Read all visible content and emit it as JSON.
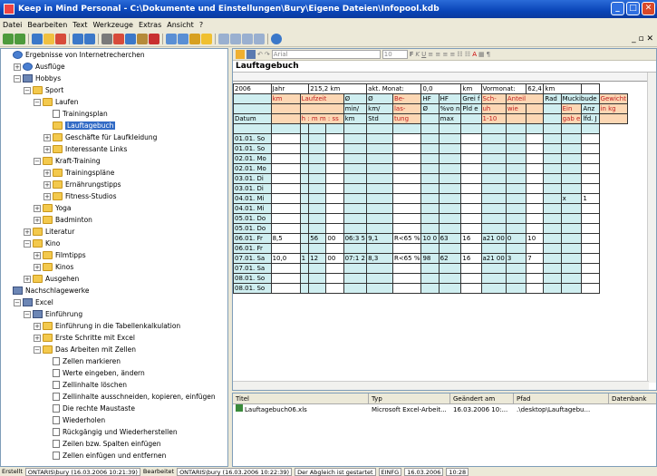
{
  "window": {
    "title": "Keep in Mind Personal - C:\\Dokumente und Einstellungen\\Bury\\Eigene Dateien\\Infopool.kdb"
  },
  "menu": [
    "Datei",
    "Bearbeiten",
    "Text",
    "Werkzeuge",
    "Extras",
    "Ansicht",
    "?"
  ],
  "format": {
    "font": "Arial",
    "size": "10"
  },
  "tree": [
    {
      "label": "Ergebnisse von Internetrecherchen",
      "depth": 0,
      "icon": "globe",
      "pm": ""
    },
    {
      "label": "Ausflüge",
      "depth": 1,
      "icon": "globe",
      "pm": "+"
    },
    {
      "label": "Hobbys",
      "depth": 1,
      "icon": "book",
      "pm": "-"
    },
    {
      "label": "Sport",
      "depth": 2,
      "icon": "folder",
      "pm": "-"
    },
    {
      "label": "Laufen",
      "depth": 3,
      "icon": "folder",
      "pm": "-"
    },
    {
      "label": "Trainingsplan",
      "depth": 4,
      "icon": "page",
      "pm": ""
    },
    {
      "label": "Lauftagebuch",
      "depth": 4,
      "icon": "folder",
      "pm": "",
      "selected": true
    },
    {
      "label": "Geschäfte für Laufkleidung",
      "depth": 4,
      "icon": "folder",
      "pm": "+"
    },
    {
      "label": "Interessante Links",
      "depth": 4,
      "icon": "folder",
      "pm": "+"
    },
    {
      "label": "Kraft-Training",
      "depth": 3,
      "icon": "folder",
      "pm": "-"
    },
    {
      "label": "Trainingspläne",
      "depth": 4,
      "icon": "folder",
      "pm": "+"
    },
    {
      "label": "Ernährungstipps",
      "depth": 4,
      "icon": "folder",
      "pm": "+"
    },
    {
      "label": "Fitness-Studios",
      "depth": 4,
      "icon": "folder",
      "pm": "+"
    },
    {
      "label": "Yoga",
      "depth": 3,
      "icon": "folder",
      "pm": "+"
    },
    {
      "label": "Badminton",
      "depth": 3,
      "icon": "folder",
      "pm": "+"
    },
    {
      "label": "Literatur",
      "depth": 2,
      "icon": "folder",
      "pm": "+"
    },
    {
      "label": "Kino",
      "depth": 2,
      "icon": "folder",
      "pm": "-"
    },
    {
      "label": "Filmtipps",
      "depth": 3,
      "icon": "folder",
      "pm": "+"
    },
    {
      "label": "Kinos",
      "depth": 3,
      "icon": "folder",
      "pm": "+"
    },
    {
      "label": "Ausgehen",
      "depth": 2,
      "icon": "folder",
      "pm": "+"
    },
    {
      "label": "Nachschlagewerke",
      "depth": 0,
      "icon": "book",
      "pm": ""
    },
    {
      "label": "Excel",
      "depth": 1,
      "icon": "book",
      "pm": "-"
    },
    {
      "label": "Einführung",
      "depth": 2,
      "icon": "book",
      "pm": "-"
    },
    {
      "label": "Einführung in die Tabellenkalkulation",
      "depth": 3,
      "icon": "folder",
      "pm": "+"
    },
    {
      "label": "Erste Schritte mit Excel",
      "depth": 3,
      "icon": "folder",
      "pm": "+"
    },
    {
      "label": "Das Arbeiten mit Zellen",
      "depth": 3,
      "icon": "folder",
      "pm": "-"
    },
    {
      "label": "Zellen markieren",
      "depth": 4,
      "icon": "page",
      "pm": ""
    },
    {
      "label": "Werte eingeben, ändern",
      "depth": 4,
      "icon": "page",
      "pm": ""
    },
    {
      "label": "Zellinhalte löschen",
      "depth": 4,
      "icon": "page",
      "pm": ""
    },
    {
      "label": "Zellinhalte ausschneiden, kopieren, einfügen",
      "depth": 4,
      "icon": "page",
      "pm": ""
    },
    {
      "label": "Die rechte Maustaste",
      "depth": 4,
      "icon": "page",
      "pm": ""
    },
    {
      "label": "Wiederholen",
      "depth": 4,
      "icon": "page",
      "pm": ""
    },
    {
      "label": "Rückgängig und Wiederherstellen",
      "depth": 4,
      "icon": "page",
      "pm": ""
    },
    {
      "label": "Zeilen bzw. Spalten einfügen",
      "depth": 4,
      "icon": "page",
      "pm": ""
    },
    {
      "label": "Zellen einfügen und entfernen",
      "depth": 4,
      "icon": "page",
      "pm": ""
    }
  ],
  "doc": {
    "title": "Lauftagebuch"
  },
  "sheet": {
    "h1": [
      "2006",
      "Jahr",
      "215,2 km",
      "akt. Monat:",
      "0,0",
      "km",
      "Vormonat:",
      "62,4",
      "km"
    ],
    "h2": [
      "km",
      "Laufzeit",
      "Ø",
      "Ø",
      "Be-",
      "HF",
      "HF",
      "Grei f",
      "Sch-",
      "Anteil",
      "Rad",
      "Muckibude",
      "Gewicht"
    ],
    "h3": [
      "min/",
      "km/",
      "las-",
      "Ø",
      "%vo n",
      "Pld e",
      "uh",
      "wie",
      "Ein",
      "Anz",
      "in kg",
      "BMI"
    ],
    "h4": [
      "Datum",
      "h : m m : ss",
      "km",
      "Std",
      "tung",
      "max",
      "1-10",
      "gab e",
      "lfd. J"
    ],
    "rows": [
      [
        "01.01. So",
        "",
        "",
        "",
        "",
        "",
        "",
        "",
        "",
        "",
        "",
        "",
        "",
        "",
        "",
        "",
        ""
      ],
      [
        "01.01. So",
        "",
        "",
        "",
        "",
        "",
        "",
        "",
        "",
        "",
        "",
        "",
        "",
        "",
        "",
        "",
        ""
      ],
      [
        "02.01. Mo",
        "",
        "",
        "",
        "",
        "",
        "",
        "",
        "",
        "",
        "",
        "",
        "",
        "",
        "",
        "",
        ""
      ],
      [
        "02.01. Mo",
        "",
        "",
        "",
        "",
        "",
        "",
        "",
        "",
        "",
        "",
        "",
        "",
        "",
        "",
        "",
        ""
      ],
      [
        "03.01. Di",
        "",
        "",
        "",
        "",
        "",
        "",
        "",
        "",
        "",
        "",
        "",
        "",
        "",
        "",
        "",
        ""
      ],
      [
        "03.01. Di",
        "",
        "",
        "",
        "",
        "",
        "",
        "",
        "",
        "",
        "",
        "",
        "",
        "",
        "",
        "",
        ""
      ],
      [
        "04.01. Mi",
        "",
        "",
        "",
        "",
        "",
        "",
        "",
        "",
        "",
        "",
        "",
        "",
        "",
        "",
        "x",
        "1"
      ],
      [
        "04.01. Mi",
        "",
        "",
        "",
        "",
        "",
        "",
        "",
        "",
        "",
        "",
        "",
        "",
        "",
        "",
        "",
        ""
      ],
      [
        "05.01. Do",
        "",
        "",
        "",
        "",
        "",
        "",
        "",
        "",
        "",
        "",
        "",
        "",
        "",
        "",
        "",
        ""
      ],
      [
        "05.01. Do",
        "",
        "",
        "",
        "",
        "",
        "",
        "",
        "",
        "",
        "",
        "",
        "",
        "",
        "",
        "",
        ""
      ],
      [
        "06.01. Fr",
        "8,5",
        "",
        "56",
        "00",
        "06:3 5",
        "9,1",
        "R<65 %",
        "10 0",
        "63",
        "16",
        "a21 00",
        "0",
        "10",
        "",
        "",
        ""
      ],
      [
        "06.01. Fr",
        "",
        "",
        "",
        "",
        "",
        "",
        "",
        "",
        "",
        "",
        "",
        "",
        "",
        "",
        "",
        ""
      ],
      [
        "07.01. Sa",
        "10,0",
        "1",
        "12",
        "00",
        "07:1 2",
        "8,3",
        "R<65 %",
        "98",
        "62",
        "16",
        "a21 00",
        "3",
        "7",
        "",
        "",
        ""
      ],
      [
        "07.01. Sa",
        "",
        "",
        "",
        "",
        "",
        "",
        "",
        "",
        "",
        "",
        "",
        "",
        "",
        "",
        "",
        ""
      ],
      [
        "08.01. So",
        "",
        "",
        "",
        "",
        "",
        "",
        "",
        "",
        "",
        "",
        "",
        "",
        "",
        "",
        "",
        ""
      ],
      [
        "08.01. So",
        "",
        "",
        "",
        "",
        "",
        "",
        "",
        "",
        "",
        "",
        "",
        "",
        "",
        "",
        "",
        ""
      ]
    ]
  },
  "files": {
    "headers": [
      "Titel",
      "Typ",
      "Geändert am",
      "Pfad",
      "Datenbank"
    ],
    "rows": [
      [
        "Lauftagebuch06.xls",
        "Microsoft Excel-Arbeit...",
        "16.03.2006 10:...",
        ".\\desktop\\Lauftagebu...",
        ""
      ]
    ]
  },
  "status": {
    "created_label": "Erstellt",
    "created": "ONTARIS\\bury (16.03.2006 10:21:39)",
    "edited_label": "Bearbeitet",
    "edited": "ONTARIS\\bury (16.03.2006 10:22:39)",
    "sync": "Der Abgleich ist gestartet",
    "mode": "EINFG",
    "date": "16.03.2006",
    "time": "10:28"
  }
}
